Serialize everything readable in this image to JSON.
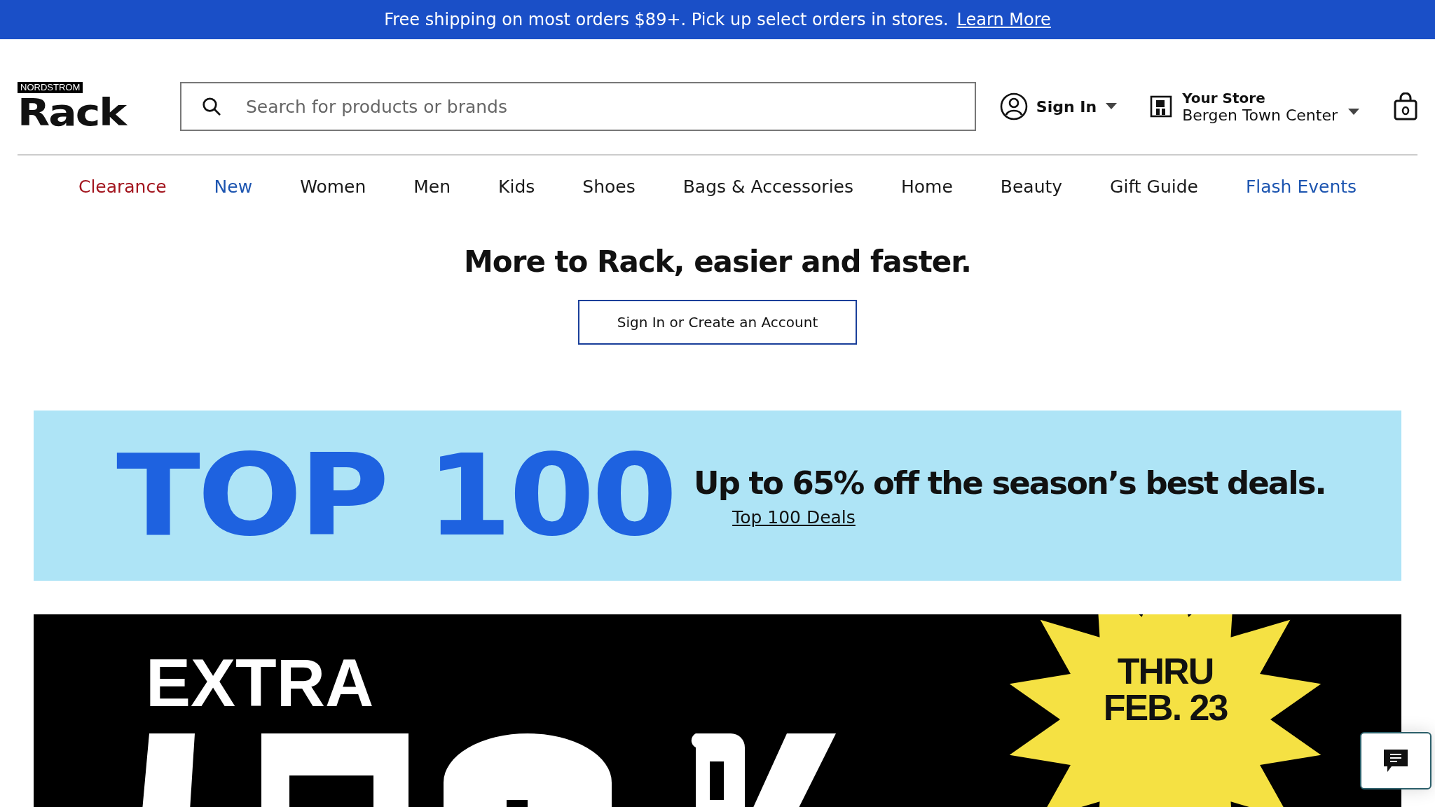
{
  "promo_bar": {
    "text": "Free shipping on most orders $89+. Pick up select orders in stores.",
    "link": "Learn More"
  },
  "header": {
    "logo": {
      "small": "NORDSTROM",
      "large": "Rack"
    },
    "search": {
      "placeholder": "Search for products or brands"
    },
    "account": {
      "label": "Sign In"
    },
    "store": {
      "title": "Your Store",
      "name": "Bergen Town Center"
    }
  },
  "nav": [
    {
      "label": "Clearance",
      "color": "#a3161f"
    },
    {
      "label": "New",
      "color": "#1d55b0"
    },
    {
      "label": "Women",
      "color": "#1a1a1a"
    },
    {
      "label": "Men",
      "color": "#1a1a1a"
    },
    {
      "label": "Kids",
      "color": "#1a1a1a"
    },
    {
      "label": "Shoes",
      "color": "#1a1a1a"
    },
    {
      "label": "Bags & Accessories",
      "color": "#1a1a1a"
    },
    {
      "label": "Home",
      "color": "#1a1a1a"
    },
    {
      "label": "Beauty",
      "color": "#1a1a1a"
    },
    {
      "label": "Gift Guide",
      "color": "#1a1a1a"
    },
    {
      "label": "Flash Events",
      "color": "#1d55b0"
    }
  ],
  "welcome": {
    "heading": "More to Rack, easier and faster.",
    "button": "Sign In or Create an Account"
  },
  "top100_banner": {
    "title": "TOP 100",
    "subtitle": "Up to 65% off the season’s best deals.",
    "link": "Top 100 Deals"
  },
  "extra_banner": {
    "label": "EXTRA",
    "badge_lines": [
      "THRU",
      "FEB. 23"
    ]
  }
}
